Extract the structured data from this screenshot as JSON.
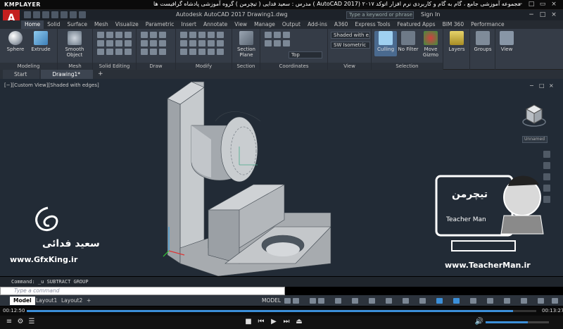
{
  "player": {
    "logo": "KMPLAYER",
    "title": "مجموعه آموزشی جامع ، گام به گام و کاربردی نرم افزار  اتوکد ۲۰۱۷ (AutoCAD 2017 )  مدرس : سعید فدایی ( تیچرمن ) گروه آموزشی پادشاه گرافیست ها",
    "time_elapsed": "00:12:50",
    "time_total": "00:13:27",
    "progress": 0.954,
    "volume": 0.67
  },
  "app": {
    "logo": "A",
    "title": "Autodesk AutoCAD 2017    Drawing1.dwg",
    "search_placeholder": "Type a keyword or phrase",
    "signin": "Sign In"
  },
  "ribbon_tabs": [
    "Home",
    "Solid",
    "Surface",
    "Mesh",
    "Visualize",
    "Parametric",
    "Insert",
    "Annotate",
    "View",
    "Manage",
    "Output",
    "Add-ins",
    "A360",
    "Express Tools",
    "Featured Apps",
    "BIM 360",
    "Performance"
  ],
  "ribbon_active_tab": "Home",
  "ribbon": {
    "sphere": "Sphere",
    "extrude": "Extrude",
    "smooth_object": "Smooth Object",
    "section_plane": "Section Plane",
    "culling": "Culling",
    "no_filter": "No Filter",
    "move_gizmo": "Move Gizmo",
    "layers": "Layers",
    "groups": "Groups",
    "view": "View",
    "visual_style": "Shaded with e...",
    "view_preset": "SW Isometric",
    "coord_top": "Top",
    "groups_labels": {
      "modeling": "Modeling",
      "mesh": "Mesh",
      "solid_editing": "Solid Editing",
      "draw": "Draw",
      "modify": "Modify",
      "section": "Section",
      "coordinates": "Coordinates",
      "view": "View",
      "selection": "Selection"
    }
  },
  "file_tabs": {
    "start": "Start",
    "drawing": "Drawing1*",
    "plus": "+"
  },
  "viewport": {
    "label": "[−][Custom View][Shaded with edges]",
    "viewcube_menu": "Unnamed",
    "ctrl_min": "−",
    "ctrl_restore": "□",
    "ctrl_close": "×"
  },
  "watermark": {
    "name": "سعید فدائی",
    "url_left": "www.GfxKing.ir",
    "url_right": "www.TeacherMan.ir",
    "badge_title": "تیچرمن",
    "badge_sub": "Teacher Man"
  },
  "command": {
    "history": "Command: _u SUBTRACT GROUP",
    "placeholder": "Type a command"
  },
  "layout_tabs": [
    "Model",
    "Layout1",
    "Layout2"
  ],
  "status": {
    "model": "MODEL"
  },
  "colors": {
    "viewport_bg": "#222b36",
    "ribbon_bg": "#353c47",
    "autocad_red": "#c41f1f",
    "model_gray": "#a8acb0"
  }
}
